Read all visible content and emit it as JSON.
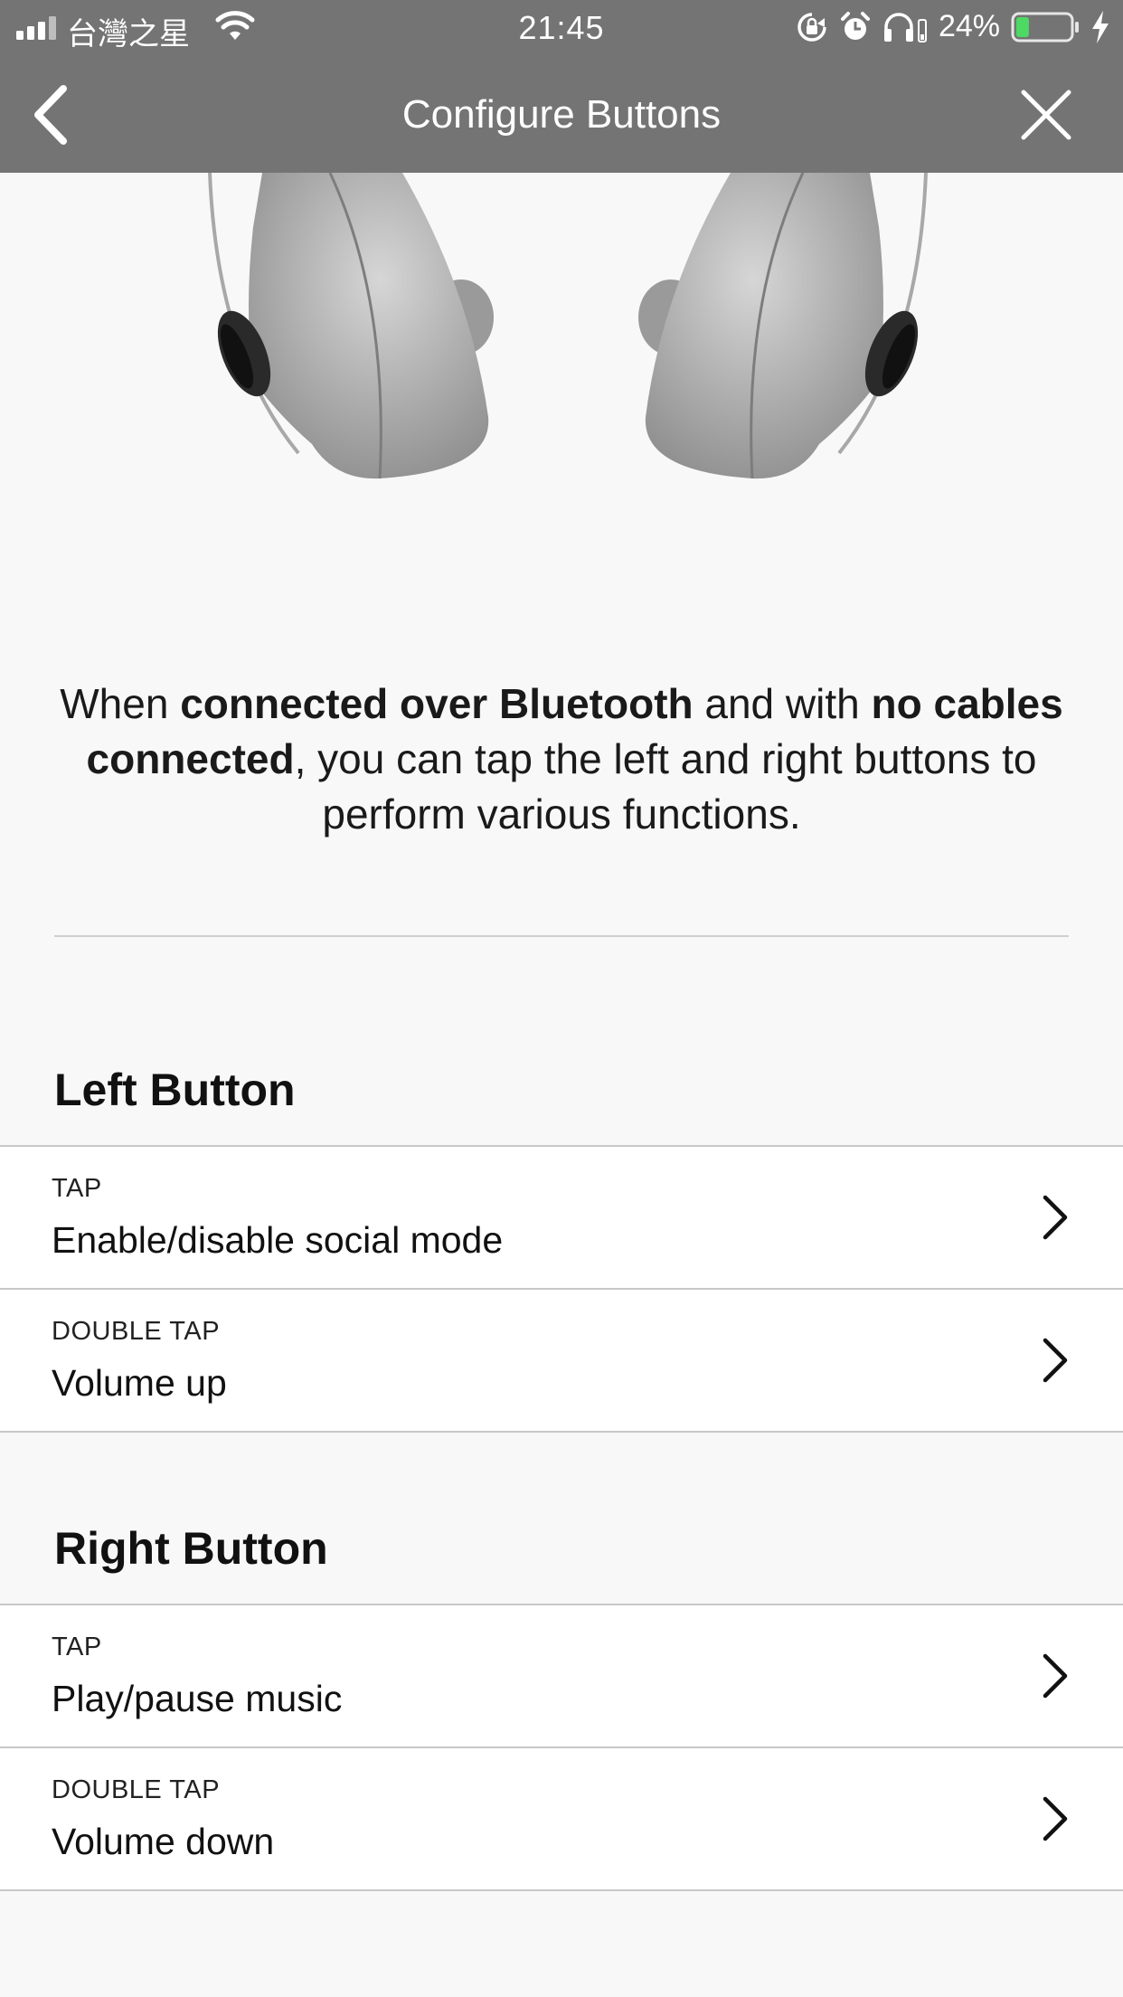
{
  "status_bar": {
    "carrier": "台灣之星",
    "time": "21:45",
    "battery_percent": "24%",
    "battery_level": 0.24,
    "icons": [
      "signal-icon",
      "wifi-icon",
      "rotation-lock-icon",
      "alarm-icon",
      "headphones-icon",
      "battery-icon",
      "charging-bolt-icon"
    ]
  },
  "nav": {
    "title": "Configure Buttons",
    "back_icon": "chevron-left-icon",
    "close_icon": "close-icon"
  },
  "intro": {
    "parts": [
      {
        "text": "When ",
        "bold": false
      },
      {
        "text": "connected over Bluetooth",
        "bold": true
      },
      {
        "text": " and with ",
        "bold": false
      },
      {
        "text": "no cables connected",
        "bold": true
      },
      {
        "text": ", you can tap the left and right buttons to perform various functions.",
        "bold": false
      }
    ]
  },
  "sections": {
    "left": {
      "title": "Left Button",
      "rows": [
        {
          "caption": "TAP",
          "value": "Enable/disable social mode"
        },
        {
          "caption": "DOUBLE TAP",
          "value": "Volume up"
        }
      ]
    },
    "right": {
      "title": "Right Button",
      "rows": [
        {
          "caption": "TAP",
          "value": "Play/pause music"
        },
        {
          "caption": "DOUBLE TAP",
          "value": "Volume down"
        }
      ]
    }
  },
  "colors": {
    "bar_background": "#747474",
    "page_background": "#f8f8f8",
    "battery_fill": "#4cd964"
  }
}
